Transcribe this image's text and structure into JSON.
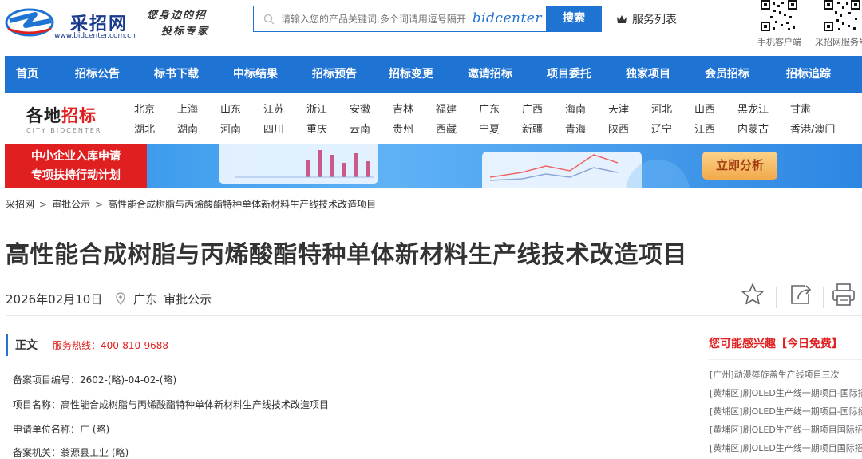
{
  "header": {
    "logo_cn": "采招网",
    "logo_url": "www.bidcenter.com.cn",
    "slogan_line1": "您身边的招",
    "slogan_line2": "投标专家",
    "search_placeholder": "请输入您的产品关键词,多个词请用逗号隔开",
    "search_brand": "bidcenter",
    "search_button": "搜索",
    "service_list": "服务列表",
    "qr_labels": [
      "手机客户端",
      "采招网服务号"
    ]
  },
  "nav": {
    "items": [
      "首页",
      "招标公告",
      "标书下载",
      "中标结果",
      "招标预告",
      "招标变更",
      "邀请招标",
      "项目委托",
      "独家项目",
      "会员招标",
      "招标追踪"
    ]
  },
  "cities": {
    "title_black": "各地",
    "title_red": "招标",
    "subtitle": "CITY BIDCENTER",
    "row1": [
      "北京",
      "上海",
      "山东",
      "江苏",
      "浙江",
      "安徽",
      "吉林",
      "福建",
      "广东",
      "广西",
      "海南",
      "天津",
      "河北",
      "山西",
      "黑龙江",
      "甘肃"
    ],
    "row2": [
      "湖北",
      "湖南",
      "河南",
      "四川",
      "重庆",
      "云南",
      "贵州",
      "西藏",
      "宁夏",
      "新疆",
      "青海",
      "陕西",
      "辽宁",
      "江西",
      "内蒙古",
      "香港/澳门"
    ]
  },
  "banner": {
    "line1": "中小企业入库申请",
    "line2": "专项扶持行动计划",
    "button": "立即分析"
  },
  "breadcrumb": {
    "items": [
      "采招网",
      "审批公示",
      "高性能合成树脂与丙烯酸酯特种单体新材料生产线技术改造项目"
    ],
    "separator": ">"
  },
  "article": {
    "title": "高性能合成树脂与丙烯酸酯特种单体新材料生产线技术改造项目",
    "date": "2026年02月10日",
    "region": "广东",
    "category": "审批公示"
  },
  "content": {
    "tab_label": "正文",
    "hotline": "服务热线：400-810-9688",
    "fields": [
      "备案项目编号：2602-(略)-04-02-(略)",
      "项目名称：高性能合成树脂与丙烯酸酯特种单体新材料生产线技术改造项目",
      "申请单位名称：广 (略)",
      "备案机关：翁源县工业 (略)"
    ]
  },
  "sidebar": {
    "title": "您可能感兴趣【今日免费】",
    "items": [
      "[广州]动漫篌旋盖生产线项目三次",
      "[黄埔区]刷OLED生产线一期项目-国际招",
      "[黄埔区]刷OLED生产线一期项目-国际招",
      "[黄埔区]刷OLED生产线一期项目国际招标",
      "[黄埔区]刷OLED生产线一期项目国际招标"
    ]
  },
  "colors": {
    "brand_blue": "#1f73d3",
    "accent_red": "#e02020"
  }
}
